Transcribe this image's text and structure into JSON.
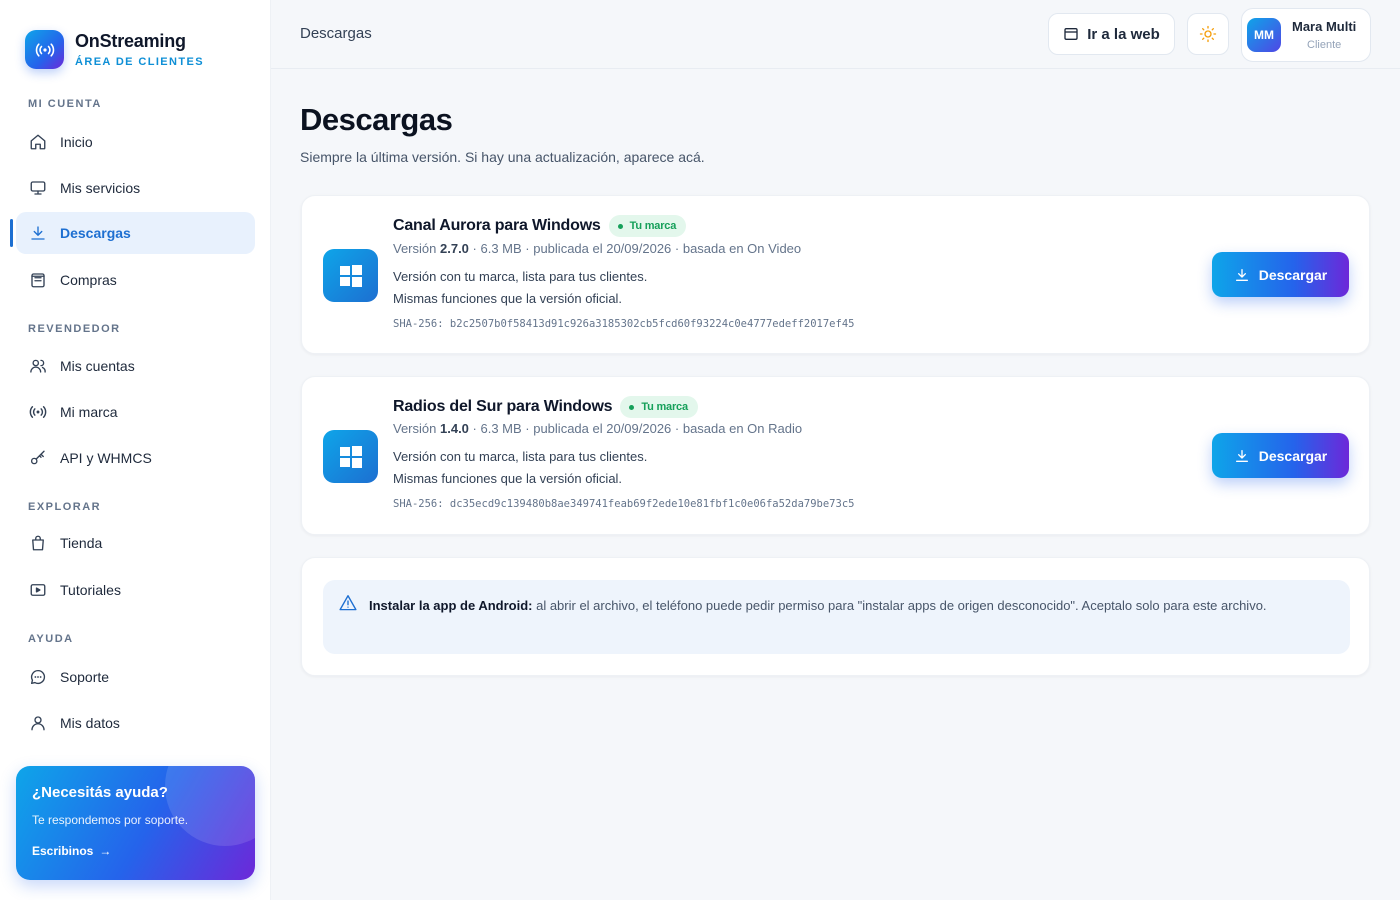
{
  "brand": {
    "name": "OnStreaming",
    "subtitle": "ÁREA DE CLIENTES"
  },
  "sidebar": {
    "sections": [
      {
        "label": "MI CUENTA"
      },
      {
        "label": "REVENDEDOR"
      },
      {
        "label": "EXPLORAR"
      },
      {
        "label": "AYUDA"
      }
    ],
    "items": [
      {
        "label": "Inicio",
        "icon": "home-icon"
      },
      {
        "label": "Mis servicios",
        "icon": "monitor-icon"
      },
      {
        "label": "Descargas",
        "icon": "download-icon",
        "active": true
      },
      {
        "label": "Compras",
        "icon": "receipt-icon"
      },
      {
        "label": "Mis cuentas",
        "icon": "users-icon"
      },
      {
        "label": "Mi marca",
        "icon": "broadcast-icon"
      },
      {
        "label": "API y WHMCS",
        "icon": "key-icon"
      },
      {
        "label": "Tienda",
        "icon": "shopping-bag-icon"
      },
      {
        "label": "Tutoriales",
        "icon": "video-icon"
      },
      {
        "label": "Soporte",
        "icon": "chat-icon"
      },
      {
        "label": "Mis datos",
        "icon": "user-icon"
      }
    ],
    "help": {
      "title": "¿Necesitás ayuda?",
      "description": "Te respondemos por soporte.",
      "link": "Escribinos",
      "link_arrow": "→"
    }
  },
  "topbar": {
    "breadcrumb": "Descargas",
    "web_button": "Ir a la web",
    "user": {
      "initials": "MM",
      "name": "Mara Multi",
      "role": "Cliente"
    }
  },
  "main": {
    "title": "Descargas",
    "subtitle": "Siempre la última versión. Si hay una actualización, aparece acá.",
    "downloads": [
      {
        "title": "Canal Aurora para Windows",
        "badge": "Tu marca",
        "version_prefix": "Versión",
        "version": "2.7.0",
        "meta": "· 6.3 MB · publicada el 20/09/2026 · basada en On Video",
        "desc_line1": "Versión con tu marca, lista para tus clientes.",
        "desc_line2": "Mismas funciones que la versión oficial.",
        "sha": "SHA-256: b2c2507b0f58413d91c926a3185302cb5fcd60f93224c0e4777edeff2017ef45",
        "button": "Descargar"
      },
      {
        "title": "Radios del Sur para Windows",
        "badge": "Tu marca",
        "version_prefix": "Versión",
        "version": "1.4.0",
        "meta": "· 6.3 MB · publicada el 20/09/2026 · basada en On Radio",
        "desc_line1": "Versión con tu marca, lista para tus clientes.",
        "desc_line2": "Mismas funciones que la versión oficial.",
        "sha": "SHA-256: dc35ecd9c139480b8ae349741feab69f2ede10e81fbf1c0e06fa52da79be73c5",
        "button": "Descargar"
      }
    ],
    "notice": {
      "bold": "Instalar la app de Android:",
      "text": " al abrir el archivo, el teléfono puede pedir permiso para \"instalar apps de origen desconocido\". Aceptalo solo para este archivo."
    }
  },
  "colors": {
    "accent": "#1d6fd1",
    "badge_bg": "#e3f7ec",
    "badge_text": "#16a05a",
    "gradient_start": "#0ea5e9",
    "gradient_end": "#6d28d9"
  }
}
